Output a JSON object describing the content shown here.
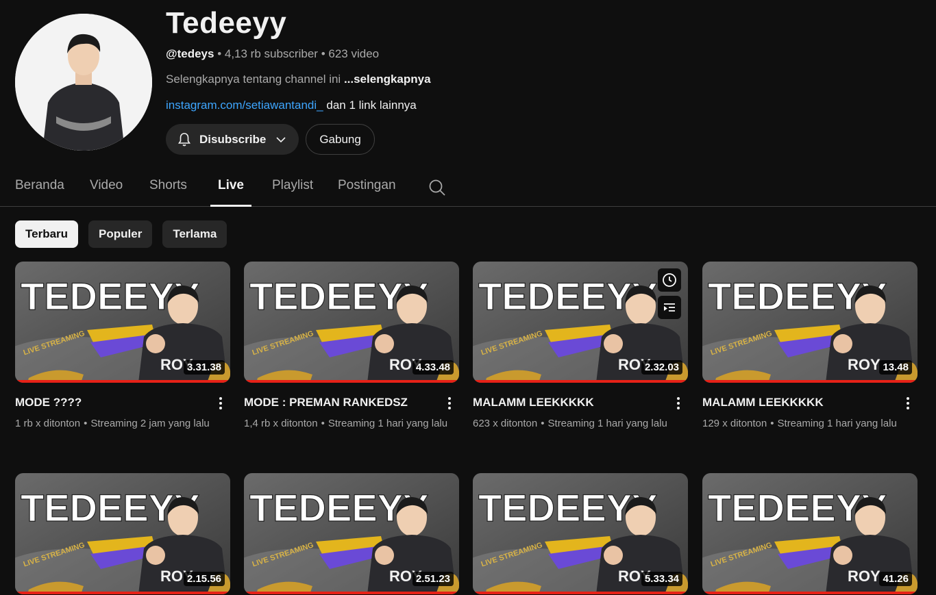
{
  "channel": {
    "name": "Tedeeyy",
    "handle": "@tedeys",
    "subscribers": "4,13 rb subscriber",
    "videos": "623 video",
    "separator": "•",
    "description": "Selengkapnya tentang channel ini",
    "description_more": "...selengkapnya",
    "link": "instagram.com/setiawantandi_",
    "link_more": "dan 1 link lainnya",
    "subscribe_label": "Disubscribe",
    "join_label": "Gabung"
  },
  "tabs": [
    {
      "label": "Beranda"
    },
    {
      "label": "Video"
    },
    {
      "label": "Shorts"
    },
    {
      "label": "Live",
      "active": true
    },
    {
      "label": "Playlist"
    },
    {
      "label": "Postingan"
    }
  ],
  "chips": [
    {
      "label": "Terbaru",
      "active": true
    },
    {
      "label": "Populer"
    },
    {
      "label": "Terlama"
    }
  ],
  "videos": [
    {
      "title": "MODE ????",
      "views": "1 rb x ditonton",
      "time": "Streaming 2 jam yang lalu",
      "duration": "3.31.38"
    },
    {
      "title": "MODE : PREMAN RANKEDSZ",
      "views": "1,4 rb x ditonton",
      "time": "Streaming 1 hari yang lalu",
      "duration": "4.33.48"
    },
    {
      "title": "MALAMM LEEKKKKK",
      "views": "623 x ditonton",
      "time": "Streaming 1 hari yang lalu",
      "duration": "2.32.03"
    },
    {
      "title": "MALAMM LEEKKKKK",
      "views": "129 x ditonton",
      "time": "Streaming 1 hari yang lalu",
      "duration": "13.48"
    },
    {
      "duration": "2.15.56"
    },
    {
      "duration": "2.51.23"
    },
    {
      "duration": "5.33.34"
    },
    {
      "duration": "41.26"
    }
  ],
  "thumbnail": {
    "headline": "TEDEEYY",
    "badge": "LIVE STREAMING",
    "shirt_text": "ROY"
  },
  "icons": {
    "bell": "bell-icon",
    "chevron": "chevron-down-icon",
    "search": "search-icon",
    "watch_later": "clock-icon",
    "queue": "add-to-queue-icon",
    "more": "more-vert-icon"
  },
  "colors": {
    "background": "#0f0f0f",
    "link": "#3ea6ff",
    "progress": "#e62117",
    "chip": "#272727"
  }
}
